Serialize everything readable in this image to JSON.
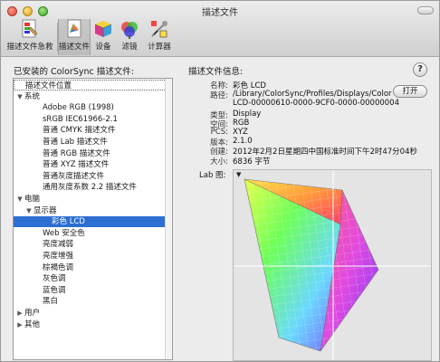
{
  "window": {
    "title": "描述文件"
  },
  "toolbar": {
    "items": [
      {
        "label": "描述文件急救",
        "icon": "first-aid-icon"
      },
      {
        "label": "描述文件",
        "icon": "profile-icon",
        "selected": true
      },
      {
        "label": "设备",
        "icon": "device-cube-icon"
      },
      {
        "label": "滤镜",
        "icon": "filter-icon"
      },
      {
        "label": "计算器",
        "icon": "calculator-icon"
      }
    ]
  },
  "left_panel": {
    "title": "已安装的 ColorSync 描述文件:",
    "rows": [
      {
        "label": "描述文件位置",
        "indent": 0,
        "tri": ""
      },
      {
        "label": "系统",
        "indent": 0,
        "tri": "▼"
      },
      {
        "label": "Adobe RGB (1998)",
        "indent": 2,
        "tri": ""
      },
      {
        "label": "sRGB IEC61966-2.1",
        "indent": 2,
        "tri": ""
      },
      {
        "label": "普通 CMYK 描述文件",
        "indent": 2,
        "tri": ""
      },
      {
        "label": "普通 Lab 描述文件",
        "indent": 2,
        "tri": ""
      },
      {
        "label": "普通 RGB 描述文件",
        "indent": 2,
        "tri": ""
      },
      {
        "label": "普通 XYZ 描述文件",
        "indent": 2,
        "tri": ""
      },
      {
        "label": "普通灰度描述文件",
        "indent": 2,
        "tri": ""
      },
      {
        "label": "通用灰度系数 2.2 描述文件",
        "indent": 2,
        "tri": ""
      },
      {
        "label": "电脑",
        "indent": 0,
        "tri": "▼"
      },
      {
        "label": "显示器",
        "indent": 1,
        "tri": "▼"
      },
      {
        "label": "彩色 LCD",
        "indent": 3,
        "tri": "",
        "selected": true
      },
      {
        "label": "Web 安全色",
        "indent": 2,
        "tri": ""
      },
      {
        "label": "亮度减弱",
        "indent": 2,
        "tri": ""
      },
      {
        "label": "亮度增强",
        "indent": 2,
        "tri": ""
      },
      {
        "label": "棕褐色调",
        "indent": 2,
        "tri": ""
      },
      {
        "label": "灰色调",
        "indent": 2,
        "tri": ""
      },
      {
        "label": "蓝色调",
        "indent": 2,
        "tri": ""
      },
      {
        "label": "黑白",
        "indent": 2,
        "tri": ""
      },
      {
        "label": "用户",
        "indent": 0,
        "tri": "▶"
      },
      {
        "label": "其他",
        "indent": 0,
        "tri": "▶"
      }
    ]
  },
  "right_panel": {
    "title": "描述文件信息:",
    "help_label": "?",
    "open_button": "打开",
    "fields": [
      {
        "label": "名称:",
        "value": "彩色 LCD"
      },
      {
        "label": "路径:",
        "value": "/Library/ColorSync/Profiles/Displays/Color"
      },
      {
        "label": "",
        "value": "LCD-00000610-0000-9CF0-0000-00000004"
      },
      {
        "label": "类型:",
        "value": "Display"
      },
      {
        "label": "空间:",
        "value": "RGB"
      },
      {
        "label": "PCS:",
        "value": "XYZ"
      },
      {
        "label": "版本:",
        "value": "2.1.0"
      },
      {
        "label": "创建:",
        "value": "2012年2月2日星期四中国标准时间下午2时47分04秒"
      },
      {
        "label": "大小:",
        "value": "6836 字节"
      }
    ],
    "lab_label": "Lab 图:",
    "lab_menu": "▼"
  }
}
